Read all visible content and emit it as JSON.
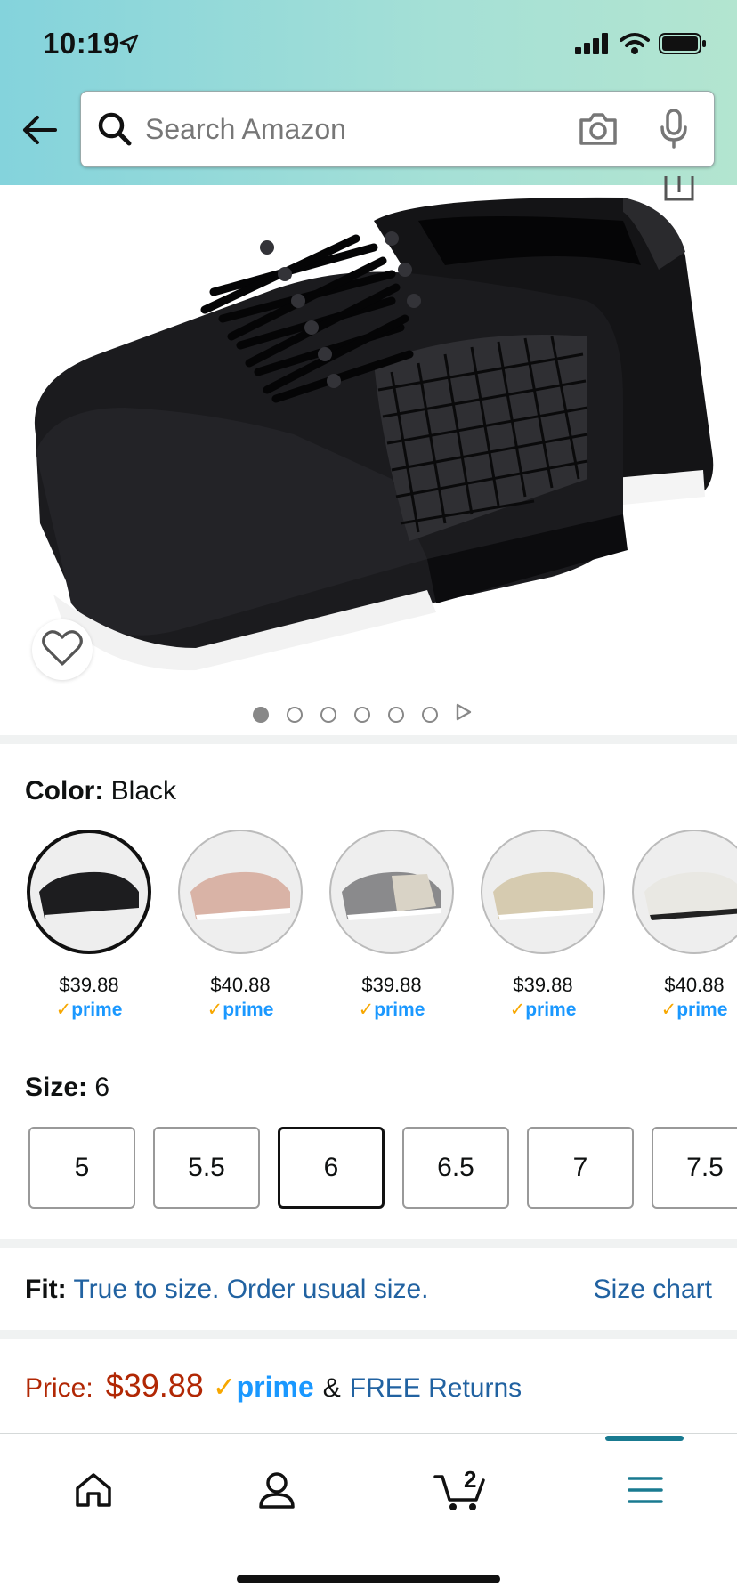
{
  "status_bar": {
    "time": "10:19"
  },
  "search": {
    "placeholder": "Search Amazon"
  },
  "product": {
    "image_count": 6,
    "active_image_index": 0
  },
  "color": {
    "label": "Color:",
    "selected": "Black",
    "swatches": [
      {
        "name": "Black",
        "price": "$39.88",
        "prime": "prime",
        "tone": "#1d1d1f"
      },
      {
        "name": "Rose",
        "price": "$40.88",
        "prime": "prime",
        "tone": "#d9b3a6"
      },
      {
        "name": "Gray",
        "price": "$39.88",
        "prime": "prime",
        "tone": "#8a8a8c"
      },
      {
        "name": "Beige",
        "price": "$39.88",
        "prime": "prime",
        "tone": "#d6cbb0"
      },
      {
        "name": "White",
        "price": "$40.88",
        "prime": "prime",
        "tone": "#e9e8e3"
      }
    ]
  },
  "size": {
    "label": "Size:",
    "selected": "6",
    "options": [
      "5",
      "5.5",
      "6",
      "6.5",
      "7",
      "7.5"
    ]
  },
  "fit": {
    "label": "Fit:",
    "text": "True to size. Order usual size.",
    "size_chart": "Size chart"
  },
  "price": {
    "label": "Price:",
    "value": "$39.88",
    "prime": "prime",
    "amp": "&",
    "returns": "FREE Returns"
  },
  "cart": {
    "count": "2"
  },
  "colors": {
    "accent": "#197a90",
    "link": "#2162a1",
    "price_red": "#b12704",
    "prime_blue": "#1a98ff",
    "prime_check": "#f7a700"
  }
}
